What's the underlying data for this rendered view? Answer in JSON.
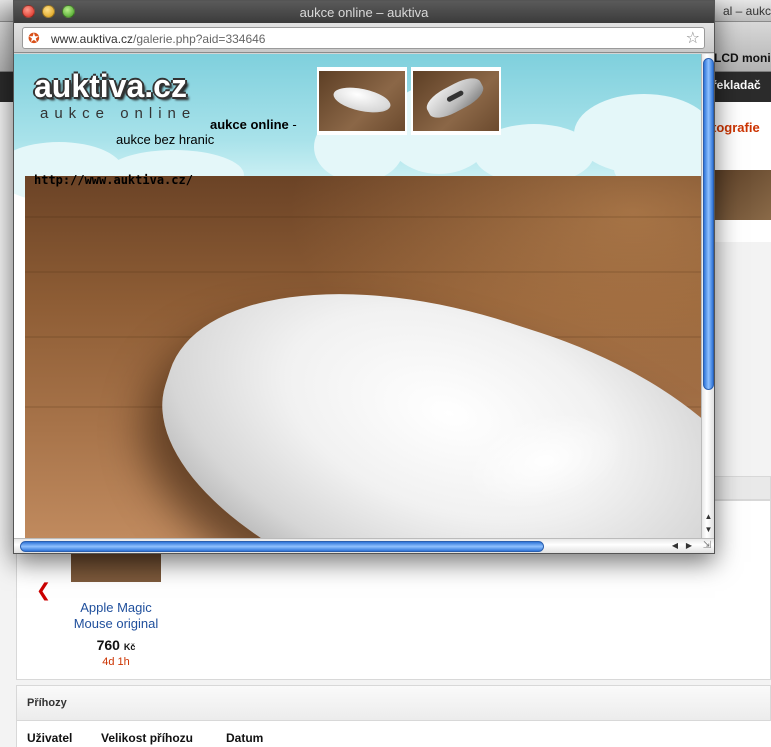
{
  "background": {
    "window_title": "al – aukc",
    "lcd_label": "LCD moni",
    "bookmark_label": "řekladač",
    "category_label": "tografie",
    "item": {
      "title": "Apple Magic Mouse original",
      "price": "760",
      "currency": "Kč",
      "time_left": "4d 1h"
    },
    "bids_section": {
      "title": "Příhozy",
      "columns": [
        "Uživatel",
        "Velikost příhozu",
        "Datum"
      ]
    },
    "prev_icon": "chevron-left-icon"
  },
  "popup": {
    "window_title": "aukce online – auktiva",
    "url_domain": "www.auktiva.cz",
    "url_path": "/galerie.php?aid=334646",
    "site_icon": "auktiva-favicon",
    "bookmark_icon": "star-icon",
    "logo": "auktiva.cz",
    "logo_sub": "aukce online",
    "tagline_bold": "aukce online",
    "tagline_dash": " -",
    "tagline_rest": "aukce bez hranic",
    "caption": "http://www.auktiva.cz/",
    "thumbnails": [
      "mouse-top-view",
      "mouse-bottom-view"
    ],
    "colors": {
      "header": "#8fd6e0",
      "scroll_thumb": "#4a8ee8",
      "title_bar": "#4a4a4a"
    }
  }
}
